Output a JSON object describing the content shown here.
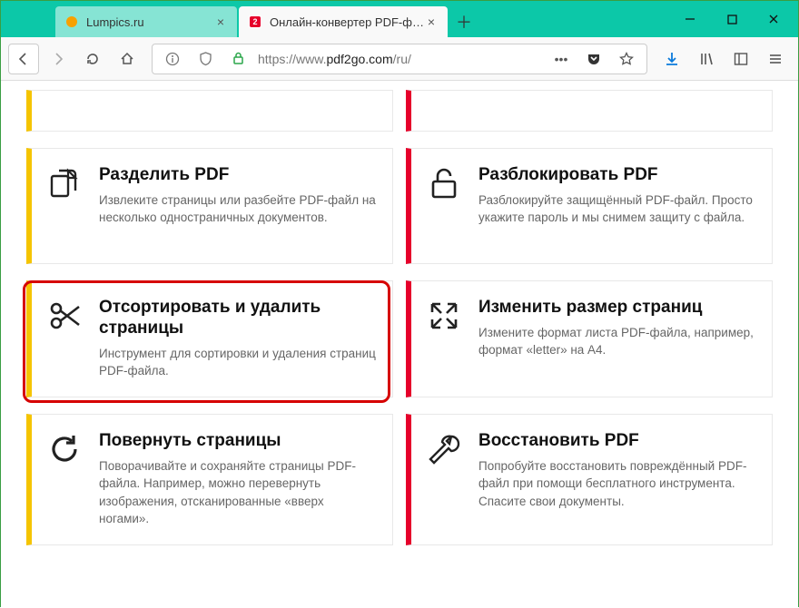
{
  "tabs": [
    {
      "title": "Lumpics.ru"
    },
    {
      "title": "Онлайн-конвертер PDF-файл"
    }
  ],
  "url": {
    "prefix": "https://www.",
    "domain": "pdf2go.com",
    "suffix": "/ru/"
  },
  "cards": {
    "split": {
      "title": "Разделить PDF",
      "desc": "Извлеките страницы или разбейте PDF-файл на несколько одностраничных документов."
    },
    "unlock": {
      "title": "Разблокировать PDF",
      "desc": "Разблокируйте защищённый PDF-файл. Просто укажите пароль и мы снимем защиту с файла."
    },
    "sort": {
      "title": "Отсортировать и удалить страницы",
      "desc": "Инструмент для сортировки и удаления страниц PDF-файла."
    },
    "resize": {
      "title": "Изменить размер страниц",
      "desc": "Измените формат листа PDF-файла, например, формат «letter» на А4."
    },
    "rotate": {
      "title": "Повернуть страницы",
      "desc": "Поворачивайте и сохраняйте страницы PDF-файла. Например, можно перевернуть изображения, отсканированные «вверх ногами»."
    },
    "repair": {
      "title": "Восстановить PDF",
      "desc": "Попробуйте восстановить повреждённый PDF-файл при помощи бесплатного инструмента. Спасите свои документы."
    }
  }
}
